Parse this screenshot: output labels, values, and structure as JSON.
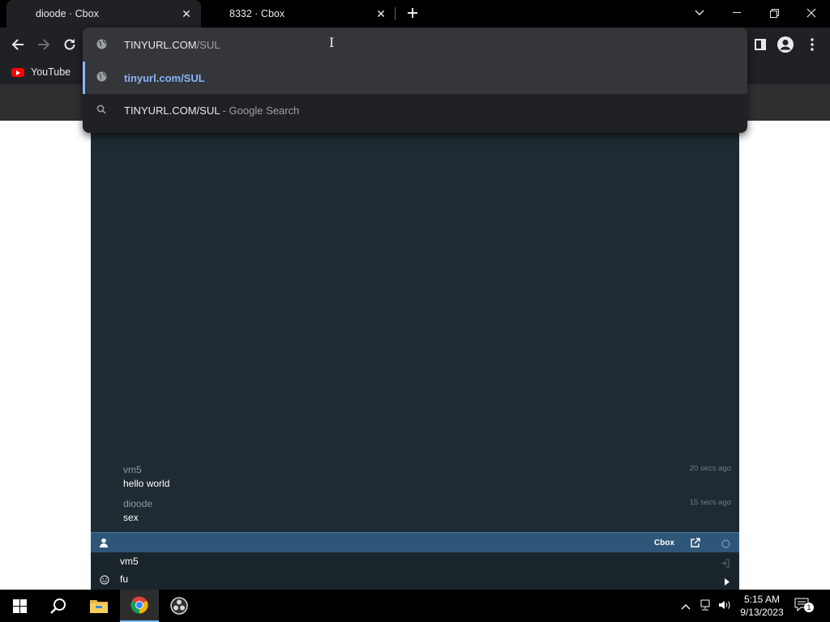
{
  "tabs": [
    {
      "title": "dioode · Cbox",
      "active": true
    },
    {
      "title": "8332 · Cbox",
      "active": false
    }
  ],
  "bookmarks": [
    {
      "label": "YouTube"
    }
  ],
  "omnibox": {
    "typed_prefix": "TINYURL.COM",
    "typed_suffix": "/SUL",
    "suggestions": [
      {
        "text": "tinyurl.com/SUL",
        "icon": "globe-icon",
        "type": "url"
      },
      {
        "text": "TINYURL.COM/SUL",
        "meta": " - Google Search",
        "icon": "search-icon",
        "type": "search"
      }
    ]
  },
  "chat": {
    "messages": [
      {
        "user": "vm5",
        "text": "hello world",
        "time": "20 secs ago"
      },
      {
        "user": "dioode",
        "text": "sex",
        "time": "15 secs ago"
      }
    ],
    "bar_brand": "Cbox",
    "input_name": "vm5",
    "input_message": "fu"
  },
  "taskbar": {
    "time": "5:15 AM",
    "date": "9/13/2023",
    "notification_count": "1"
  },
  "colors": {
    "chat_bg": "#1f2b33",
    "chat_bar": "#2e5678",
    "link": "#8ab4f8"
  }
}
